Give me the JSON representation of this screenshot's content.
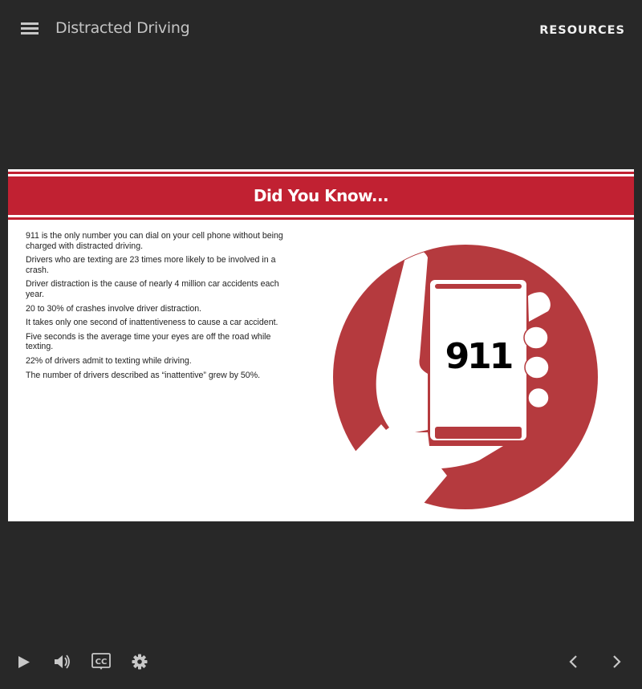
{
  "header": {
    "menu_icon": "hamburger-menu-icon",
    "title": "Distracted Driving",
    "resources_label": "RESOURCES"
  },
  "slide": {
    "banner_title": "Did You Know...",
    "facts": [
      "911 is the only number you can dial on your cell phone without being charged with distracted driving.",
      "Drivers who are texting are 23 times more likely to be involved in a crash.",
      "Driver distraction is the cause of nearly 4 million car accidents each year.",
      "20 to 30% of crashes involve driver distraction.",
      "It takes only one second of inattentiveness to cause a car accident.",
      "Five seconds is the average time your eyes are off the road while texting.",
      "22% of drivers admit to texting while driving.",
      "The number of drivers described as “inattentive” grew by 50%."
    ],
    "illustration": {
      "phone_text": "911",
      "circle_color": "#b53a3e"
    },
    "accent_color": "#c12132"
  },
  "controls": {
    "play_icon": "play-icon",
    "volume_icon": "volume-icon",
    "cc_label": "CC",
    "settings_icon": "gear-icon",
    "prev_icon": "chevron-left-icon",
    "next_icon": "chevron-right-icon"
  }
}
